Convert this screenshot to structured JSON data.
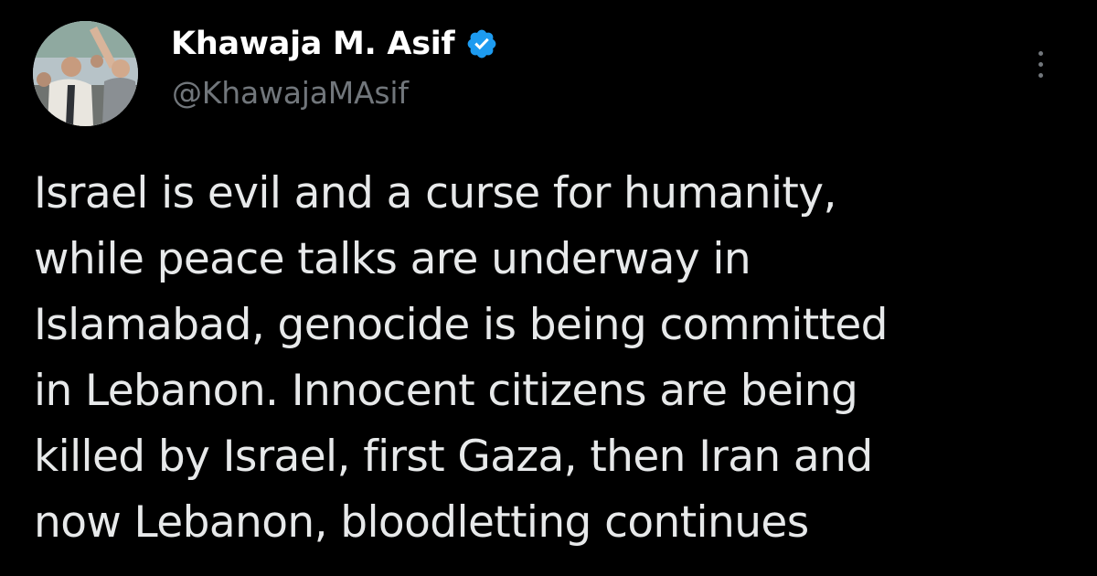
{
  "author": {
    "display_name": "Khawaja M. Asif",
    "handle": "@KhawajaMAsif",
    "verified": true,
    "avatar_icon": "profile-photo",
    "verified_icon": "verified-badge-icon",
    "verified_color": "#1d9bf0"
  },
  "more_icon": "more-vertical-icon",
  "tweet": {
    "lines": [
      "Israel is evil and a curse for humanity,",
      "while peace talks are underway in",
      "Islamabad, genocide is being committed",
      "in Lebanon. Innocent citizens are being",
      "killed by Israel, first Gaza, then Iran and",
      "now Lebanon, bloodletting continues"
    ]
  },
  "colors": {
    "background": "#000000",
    "name": "#ffffff",
    "handle": "#71767b",
    "body_text": "#e7e9ea"
  }
}
